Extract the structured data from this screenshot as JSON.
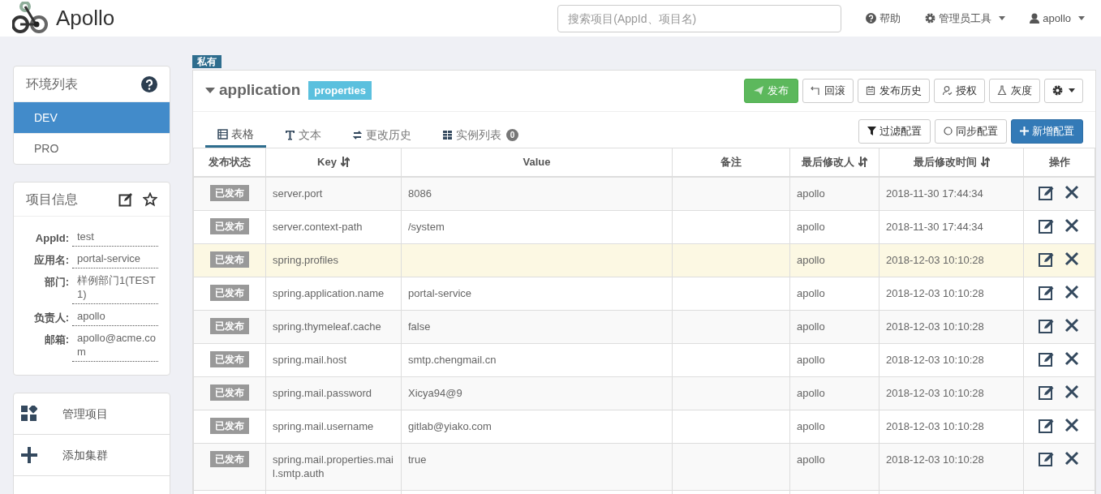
{
  "header": {
    "logo_text": "Apollo",
    "search": {
      "placeholder": "搜索项目(AppId、项目名)"
    },
    "nav": [
      {
        "kind": "help",
        "label": "帮助"
      },
      {
        "kind": "admin",
        "label": "管理员工具"
      },
      {
        "kind": "user",
        "label": "apollo"
      }
    ]
  },
  "sidebar": {
    "environments": {
      "title": "环境列表",
      "items": [
        {
          "label": "DEV",
          "selected": true
        },
        {
          "label": "PRO",
          "selected": false
        }
      ]
    },
    "project_info": {
      "title": "项目信息",
      "fields": [
        {
          "label": "AppId:",
          "value": "test"
        },
        {
          "label": "应用名:",
          "value": "portal-service"
        },
        {
          "label": "部门:",
          "value": "样例部门1(TEST1)"
        },
        {
          "label": "负责人:",
          "value": "apollo"
        },
        {
          "label": "邮箱:",
          "value": "apollo@acme.com"
        }
      ]
    },
    "actions": [
      {
        "kind": "manage",
        "label": "管理项目"
      },
      {
        "kind": "add",
        "label": "添加集群"
      }
    ]
  },
  "namespace": {
    "badge": "私有",
    "name": "application",
    "format": "properties",
    "actions": [
      {
        "kind": "publish",
        "label": "发布"
      },
      {
        "kind": "rollback",
        "label": "回滚"
      },
      {
        "kind": "history",
        "label": "发布历史"
      },
      {
        "kind": "grant",
        "label": "授权"
      },
      {
        "kind": "gray",
        "label": "灰度"
      },
      {
        "kind": "settings"
      }
    ],
    "tabs": [
      {
        "kind": "table",
        "label": "表格",
        "selected": true
      },
      {
        "kind": "text",
        "label": "文本",
        "selected": false
      },
      {
        "kind": "history",
        "label": "更改历史",
        "selected": false
      },
      {
        "kind": "instances",
        "label": "实例列表",
        "count": "0",
        "selected": false
      }
    ],
    "tools": [
      {
        "kind": "filter",
        "label": "过滤配置"
      },
      {
        "kind": "sync",
        "label": "同步配置"
      },
      {
        "kind": "add",
        "label": "新增配置"
      }
    ],
    "table": {
      "columns": [
        {
          "label": "发布状态",
          "sortable": false
        },
        {
          "label": "Key",
          "sortable": true
        },
        {
          "label": "Value",
          "sortable": false
        },
        {
          "label": "备注",
          "sortable": false
        },
        {
          "label": "最后修改人",
          "sortable": true
        },
        {
          "label": "最后修改时间",
          "sortable": true
        },
        {
          "label": "操作",
          "sortable": false
        }
      ],
      "rows": [
        {
          "status": "已发布",
          "key": "server.port",
          "value": "8086",
          "modifier": "apollo",
          "time": "2018-11-30 17:44:34",
          "highlighted": false
        },
        {
          "status": "已发布",
          "key": "server.context-path",
          "value": "/system",
          "modifier": "apollo",
          "time": "2018-11-30 17:44:34",
          "highlighted": false
        },
        {
          "status": "已发布",
          "key": "spring.profiles",
          "modifier": "apollo",
          "time": "2018-12-03 10:10:28",
          "highlighted": true
        },
        {
          "status": "已发布",
          "key": "spring.application.name",
          "value": "portal-service",
          "modifier": "apollo",
          "time": "2018-12-03 10:10:28",
          "highlighted": false
        },
        {
          "status": "已发布",
          "key": "spring.thymeleaf.cache",
          "value": "false",
          "modifier": "apollo",
          "time": "2018-12-03 10:10:28",
          "highlighted": false
        },
        {
          "status": "已发布",
          "key": "spring.mail.host",
          "value": "smtp.chengmail.cn",
          "modifier": "apollo",
          "time": "2018-12-03 10:10:28",
          "highlighted": false
        },
        {
          "status": "已发布",
          "key": "spring.mail.password",
          "value": "Xicya94@9",
          "modifier": "apollo",
          "time": "2018-12-03 10:10:28",
          "highlighted": false
        },
        {
          "status": "已发布",
          "key": "spring.mail.username",
          "value": "gitlab@yiako.com",
          "modifier": "apollo",
          "time": "2018-12-03 10:10:28",
          "highlighted": false
        },
        {
          "status": "已发布",
          "key": "spring.mail.properties.mail.smtp.auth",
          "value": "true",
          "modifier": "apollo",
          "time": "2018-12-03 10:10:28",
          "highlighted": false
        }
      ]
    }
  }
}
